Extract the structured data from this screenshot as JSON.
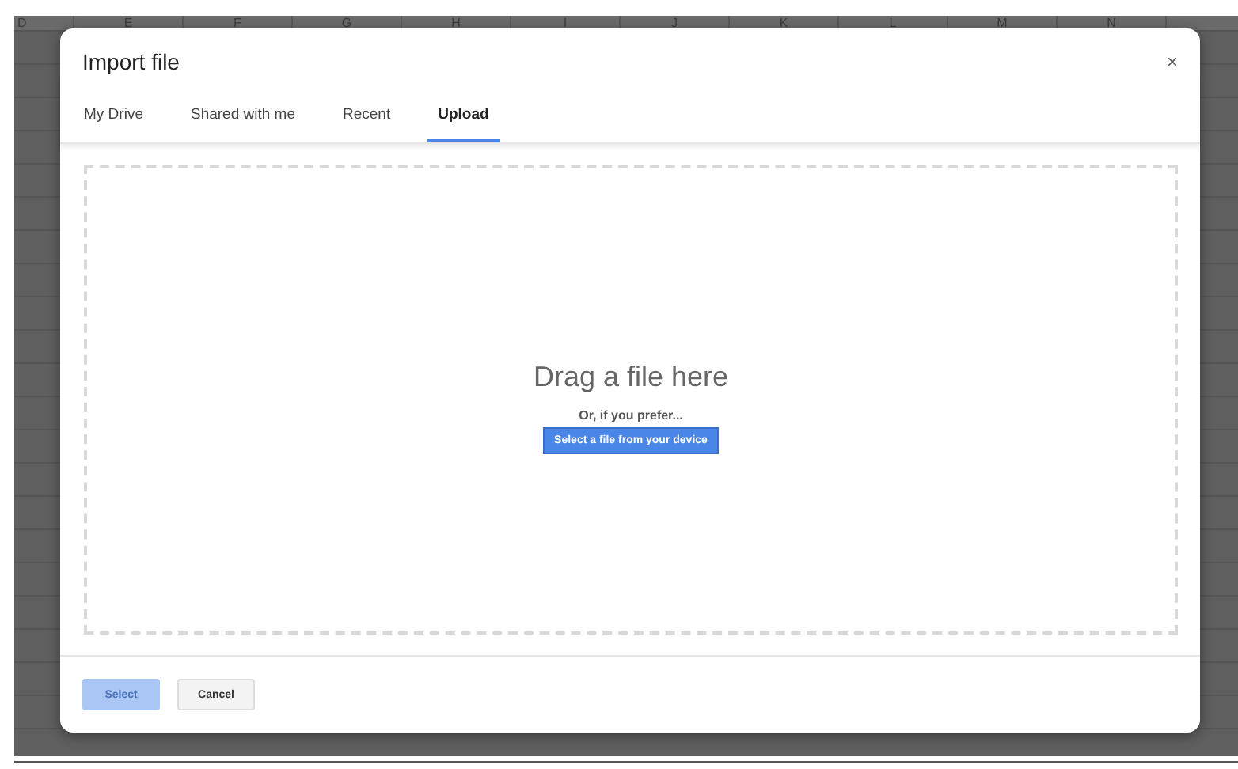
{
  "sheet": {
    "columns": [
      "D",
      "E",
      "F",
      "G",
      "H",
      "I",
      "J",
      "K",
      "L",
      "M",
      "N"
    ]
  },
  "dialog": {
    "title": "Import file",
    "close": "×",
    "tabs": [
      {
        "label": "My Drive",
        "selected": false
      },
      {
        "label": "Shared with me",
        "selected": false
      },
      {
        "label": "Recent",
        "selected": false
      },
      {
        "label": "Upload",
        "selected": true
      }
    ],
    "drop_zone": {
      "heading": "Drag a file here",
      "subtext": "Or, if you prefer...",
      "button": "Select a file from your device"
    },
    "buttons": [
      {
        "label": "Select",
        "kind": "primary",
        "disabled": true
      },
      {
        "label": "Cancel",
        "kind": "secondary",
        "disabled": false
      }
    ]
  }
}
